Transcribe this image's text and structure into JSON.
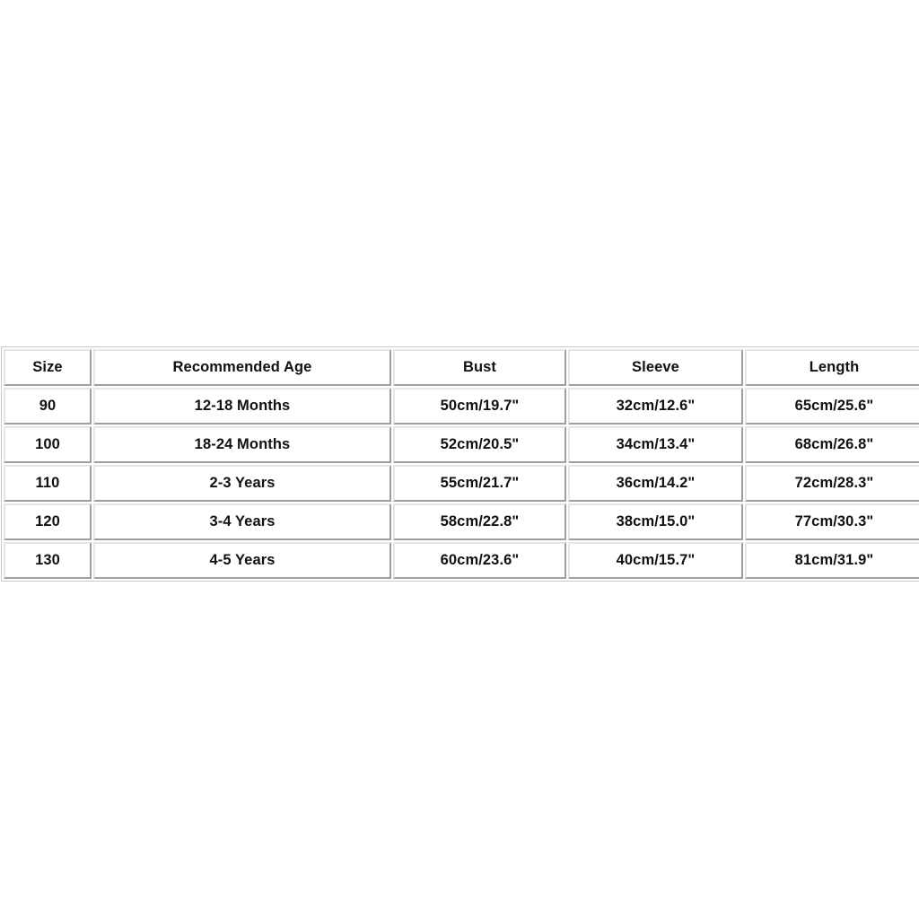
{
  "page": {
    "background_color": "#ffffff",
    "text_color": "#111111",
    "border_color_light": "#e6e6e6",
    "border_color_dark": "#9e9e9e",
    "outer_border_color": "#c9c9c9"
  },
  "size_chart": {
    "columns": [
      "Size",
      "Recommended Age",
      "Bust",
      "Sleeve",
      "Length"
    ],
    "rows": [
      {
        "size": "90",
        "age": "12-18 Months",
        "bust": "50cm/19.7\"",
        "sleeve": "32cm/12.6\"",
        "length": "65cm/25.6\""
      },
      {
        "size": "100",
        "age": "18-24 Months",
        "bust": "52cm/20.5\"",
        "sleeve": "34cm/13.4\"",
        "length": "68cm/26.8\""
      },
      {
        "size": "110",
        "age": "2-3 Years",
        "bust": "55cm/21.7\"",
        "sleeve": "36cm/14.2\"",
        "length": "72cm/28.3\""
      },
      {
        "size": "120",
        "age": "3-4 Years",
        "bust": "58cm/22.8\"",
        "sleeve": "38cm/15.0\"",
        "length": "77cm/30.3\""
      },
      {
        "size": "130",
        "age": "4-5 Years",
        "bust": "60cm/23.6\"",
        "sleeve": "40cm/15.7\"",
        "length": "81cm/31.9\""
      }
    ]
  }
}
